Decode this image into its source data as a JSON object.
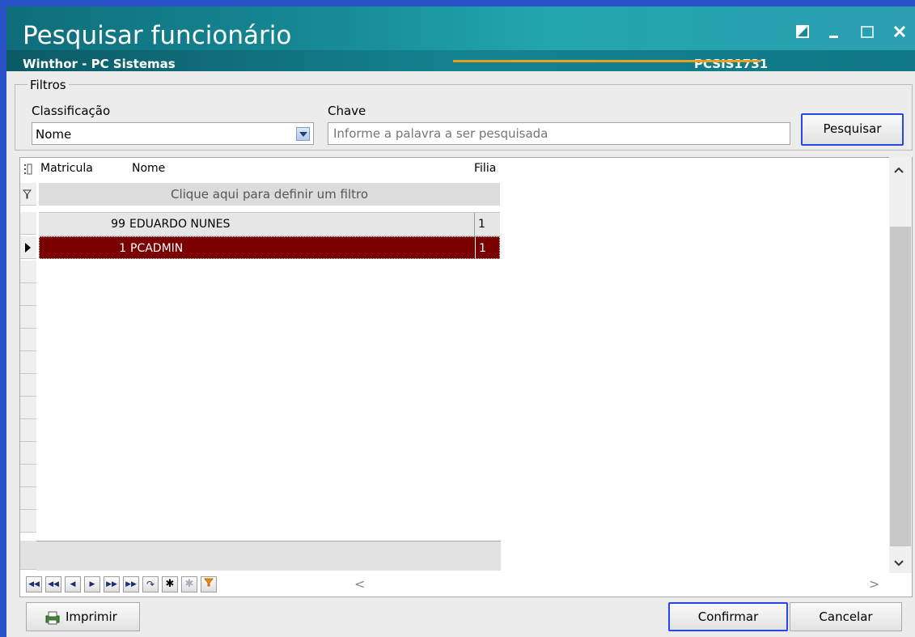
{
  "window": {
    "title": "Pesquisar funcionário",
    "app_name": "Winthor - PC Sistemas",
    "routine_code": "PCSIS1731",
    "controls": [
      "restore",
      "minimize",
      "maximize",
      "close"
    ]
  },
  "filters": {
    "group_label": "Filtros",
    "classificacao_label": "Classificação",
    "classificacao_value": "Nome",
    "chave_label": "Chave",
    "chave_placeholder": "Informe a palavra a ser pesquisada",
    "search_button": "Pesquisar"
  },
  "grid": {
    "columns": [
      "Matricula",
      "Nome",
      "Filia"
    ],
    "filter_row_text": "Clique aqui para definir um filtro",
    "rows": [
      {
        "matricula": "99",
        "nome": "EDUARDO NUNES",
        "filial": "1",
        "selected": false
      },
      {
        "matricula": "1",
        "nome": "PCADMIN",
        "filial": "1",
        "selected": true
      }
    ]
  },
  "footer": {
    "print_button": "Imprimir",
    "confirm_button": "Confirmar",
    "cancel_button": "Cancelar"
  },
  "colors": {
    "selection": "#7a0000",
    "focus_border": "#2547e8",
    "header_teal": "#168a96"
  }
}
